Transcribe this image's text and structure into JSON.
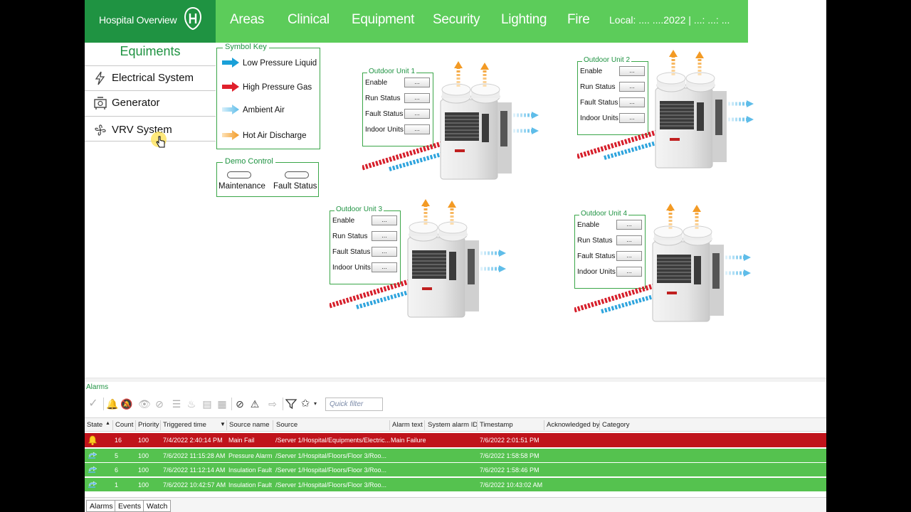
{
  "nav": {
    "brand": "Hospital Overview",
    "items": [
      "Areas",
      "Clinical",
      "Equipment",
      "Security",
      "Lighting",
      "Fire"
    ],
    "local": "Local: .... ....2022 | ...: ...: ..."
  },
  "equipment_panel": {
    "title": "Equiments",
    "items": [
      "Electrical System",
      "Generator",
      "VRV System"
    ]
  },
  "symbol_key": {
    "title": "Symbol Key",
    "items": [
      {
        "label": "Low  Pressure Liquid",
        "color": "#1aa0d8"
      },
      {
        "label": "High Pressure Gas",
        "color": "#e0202c"
      },
      {
        "label": "Ambient Air",
        "color": "#7fcbf0"
      },
      {
        "label": "Hot Air Discharge",
        "color": "#f5a030"
      }
    ]
  },
  "demo_control": {
    "title": "Demo Control",
    "items": [
      "Maintenance",
      "Fault Status"
    ]
  },
  "units": [
    {
      "title": "Outdoor Unit 1",
      "rows": [
        "Enable",
        "Run Status",
        "Fault Status",
        "Indoor Units"
      ],
      "button": "..."
    },
    {
      "title": "Outdoor Unit 2",
      "rows": [
        "Enable",
        "Run Status",
        "Fault Status",
        "Indoor Units"
      ],
      "button": "..."
    },
    {
      "title": "Outdoor Unit 3",
      "rows": [
        "Enable",
        "Run Status",
        "Fault Status",
        "Indoor Units"
      ],
      "button": "..."
    },
    {
      "title": "Outdoor Unit 4",
      "rows": [
        "Enable",
        "Run Status",
        "Fault Status",
        "Indoor Units"
      ],
      "button": "..."
    }
  ],
  "alarms": {
    "title": "Alarms",
    "quick_filter_placeholder": "Quick filter",
    "columns": [
      "State",
      "Count",
      "Priority",
      "Triggered time",
      "Source name",
      "Source",
      "Alarm text",
      "System alarm ID",
      "Timestamp",
      "Acknowledged by",
      "Category"
    ],
    "rows": [
      {
        "state": "bell-icon",
        "color": "#c0131b",
        "count": "16",
        "priority": "100",
        "triggered": "7/4/2022 2:40:14 PM",
        "source_name": "Main Fail",
        "source": "/Server 1/Hospital/Equipments/Electric...",
        "alarm_text": "Main Failure",
        "timestamp": "7/6/2022 2:01:51 PM"
      },
      {
        "state": "return-to-normal-icon",
        "color": "#55c24f",
        "count": "5",
        "priority": "100",
        "triggered": "7/6/2022 11:15:28 AM",
        "source_name": "Pressure Alarm",
        "source": "/Server 1/Hospital/Floors/Floor 3/Roo...",
        "alarm_text": "",
        "timestamp": "7/6/2022 1:58:58 PM"
      },
      {
        "state": "return-to-normal-icon",
        "color": "#55c24f",
        "count": "6",
        "priority": "100",
        "triggered": "7/6/2022 11:12:14 AM",
        "source_name": "Insulation Fault",
        "source": "/Server 1/Hospital/Floors/Floor 3/Roo...",
        "alarm_text": "",
        "timestamp": "7/6/2022 1:58:46 PM"
      },
      {
        "state": "return-to-normal-icon",
        "color": "#55c24f",
        "count": "1",
        "priority": "100",
        "triggered": "7/6/2022 10:42:57 AM",
        "source_name": "Insulation Fault",
        "source": "/Server 1/Hospital/Floors/Floor 3/Roo...",
        "alarm_text": "",
        "timestamp": "7/6/2022 10:43:02 AM"
      }
    ],
    "tabs": [
      "Alarms",
      "Events",
      "Watch"
    ]
  },
  "colors": {
    "brand_dark": "#1f9342",
    "brand_light": "#5ccc5a",
    "alarm_red": "#c0131b",
    "alarm_green": "#55c24f"
  }
}
